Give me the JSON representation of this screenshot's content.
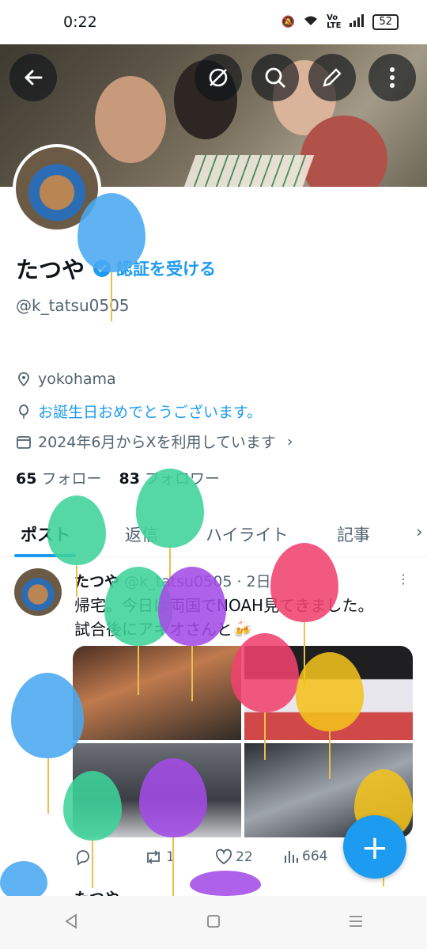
{
  "status": {
    "time": "0:22",
    "battery": "52"
  },
  "profile": {
    "name": "たつや",
    "verify_label": "認証を受ける",
    "handle": "@k_tatsu0505",
    "location": "yokohama",
    "birthday_text": "お誕生日おめでとうございます。",
    "joined": "2024年6月からXを利用しています",
    "following_count": "65",
    "following_label": "フォロー",
    "followers_count": "83",
    "followers_label": "フォロワー"
  },
  "tabs": [
    "ポスト",
    "返信",
    "ハイライト",
    "記事"
  ],
  "post": {
    "author": "たつや",
    "handle_time": "@k_tatsu0505 · 2日",
    "text_line1": "帰宅。今日は両国でNOAH見てきました。",
    "text_line2": "試合後にアキオさんと🍻",
    "reposts": "1",
    "likes": "22",
    "views": "664"
  },
  "next_post_preview": "たつや",
  "fab_label": "+",
  "colors": {
    "accent": "#1d9bf0"
  }
}
